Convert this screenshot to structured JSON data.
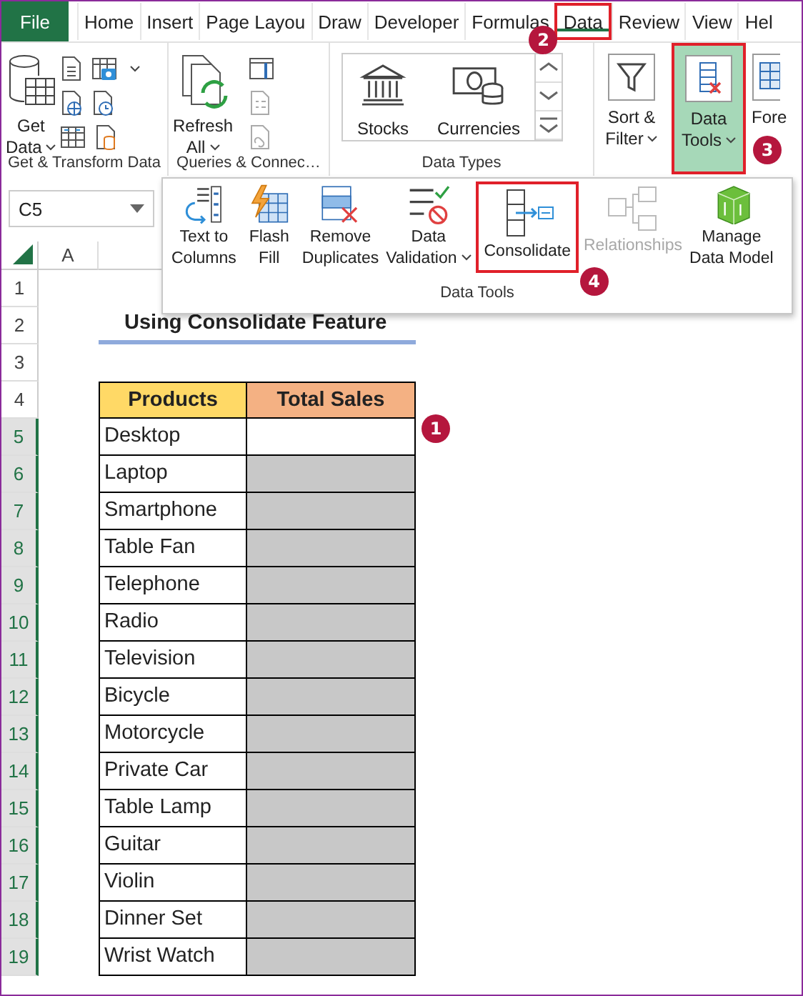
{
  "tabs": [
    {
      "label": "File",
      "kind": "file",
      "selected": false,
      "highlighted": false
    },
    {
      "label": "Home",
      "kind": "tab",
      "selected": false,
      "highlighted": false
    },
    {
      "label": "Insert",
      "kind": "tab",
      "selected": false,
      "highlighted": false
    },
    {
      "label": "Page Layou",
      "kind": "tab",
      "selected": false,
      "highlighted": false
    },
    {
      "label": "Draw",
      "kind": "tab",
      "selected": false,
      "highlighted": false
    },
    {
      "label": "Developer",
      "kind": "tab",
      "selected": false,
      "highlighted": false
    },
    {
      "label": "Formulas",
      "kind": "tab",
      "selected": false,
      "highlighted": false
    },
    {
      "label": "Data",
      "kind": "tab",
      "selected": true,
      "highlighted": true,
      "callout": "2"
    },
    {
      "label": "Review",
      "kind": "tab",
      "selected": false,
      "highlighted": false
    },
    {
      "label": "View",
      "kind": "tab",
      "selected": false,
      "highlighted": false
    },
    {
      "label": "Hel",
      "kind": "tab",
      "selected": false,
      "highlighted": false
    }
  ],
  "ribbon": {
    "groups": [
      {
        "kind": "get-transform",
        "label": "Get & Transform Data",
        "buttons": [
          {
            "label": "Get\nData",
            "dropdown": true,
            "highlighted": false
          }
        ]
      },
      {
        "kind": "queries",
        "label": "Queries & Connec…",
        "buttons": [
          {
            "label": "Refresh\nAll",
            "dropdown": true,
            "highlighted": false
          }
        ]
      },
      {
        "kind": "data-types",
        "label": "Data Types",
        "buttons": [
          {
            "label": "Stocks",
            "dropdown": false,
            "highlighted": false
          },
          {
            "label": "Currencies",
            "dropdown": false,
            "highlighted": false
          }
        ]
      },
      {
        "kind": "plain",
        "buttons": [
          {
            "label": "Sort &\nFilter",
            "dropdown": true,
            "highlighted": false
          }
        ]
      },
      {
        "kind": "plain",
        "buttons": [
          {
            "label": "Data\nTools",
            "dropdown": true,
            "highlighted": true,
            "callout": "3"
          }
        ]
      },
      {
        "kind": "edge",
        "buttons": [
          {
            "label": "Fore",
            "dropdown": false,
            "highlighted": false
          }
        ]
      }
    ]
  },
  "dropdown_panel": {
    "label": "Data Tools",
    "buttons": [
      {
        "label": "Text to\nColumns",
        "dropdown": false,
        "disabled": false,
        "highlighted": false
      },
      {
        "label": "Flash\nFill",
        "dropdown": false,
        "disabled": false,
        "highlighted": false
      },
      {
        "label": "Remove\nDuplicates",
        "dropdown": false,
        "disabled": false,
        "highlighted": false
      },
      {
        "label": "Data\nValidation",
        "dropdown": true,
        "disabled": false,
        "highlighted": false
      },
      {
        "label": "Consolidate",
        "dropdown": false,
        "disabled": false,
        "highlighted": true,
        "callout": "4"
      },
      {
        "label": "Relationships",
        "dropdown": false,
        "disabled": true,
        "highlighted": false
      },
      {
        "label": "Manage\nData Model",
        "dropdown": false,
        "disabled": false,
        "highlighted": false
      }
    ]
  },
  "name_box": {
    "value": "C5"
  },
  "columns": [
    {
      "label": "A"
    }
  ],
  "row_headers": [
    {
      "label": "1",
      "selected": false
    },
    {
      "label": "2",
      "selected": false
    },
    {
      "label": "3",
      "selected": false
    },
    {
      "label": "4",
      "selected": false
    },
    {
      "label": "5",
      "selected": true
    },
    {
      "label": "6",
      "selected": true
    },
    {
      "label": "7",
      "selected": true
    },
    {
      "label": "8",
      "selected": true
    },
    {
      "label": "9",
      "selected": true
    },
    {
      "label": "10",
      "selected": true
    },
    {
      "label": "11",
      "selected": true
    },
    {
      "label": "12",
      "selected": true
    },
    {
      "label": "13",
      "selected": true
    },
    {
      "label": "14",
      "selected": true
    },
    {
      "label": "15",
      "selected": true
    },
    {
      "label": "16",
      "selected": true
    },
    {
      "label": "17",
      "selected": true
    },
    {
      "label": "18",
      "selected": true
    },
    {
      "label": "19",
      "selected": true
    }
  ],
  "sheet_title": "Using Consolidate Feature",
  "table": {
    "columns": [
      "Products",
      "Total Sales"
    ],
    "selection_highlighted": true,
    "callout": "1",
    "rows": [
      {
        "product": "Desktop",
        "active": true
      },
      {
        "product": "Laptop",
        "active": false
      },
      {
        "product": "Smartphone",
        "active": false
      },
      {
        "product": "Table Fan",
        "active": false
      },
      {
        "product": "Telephone",
        "active": false
      },
      {
        "product": "Radio",
        "active": false
      },
      {
        "product": "Television",
        "active": false
      },
      {
        "product": "Bicycle",
        "active": false
      },
      {
        "product": "Motorcycle",
        "active": false
      },
      {
        "product": "Private Car",
        "active": false
      },
      {
        "product": "Table Lamp",
        "active": false
      },
      {
        "product": "Guitar",
        "active": false
      },
      {
        "product": "Violin",
        "active": false
      },
      {
        "product": "Dinner Set",
        "active": false
      },
      {
        "product": "Wrist Watch",
        "active": false
      }
    ]
  }
}
